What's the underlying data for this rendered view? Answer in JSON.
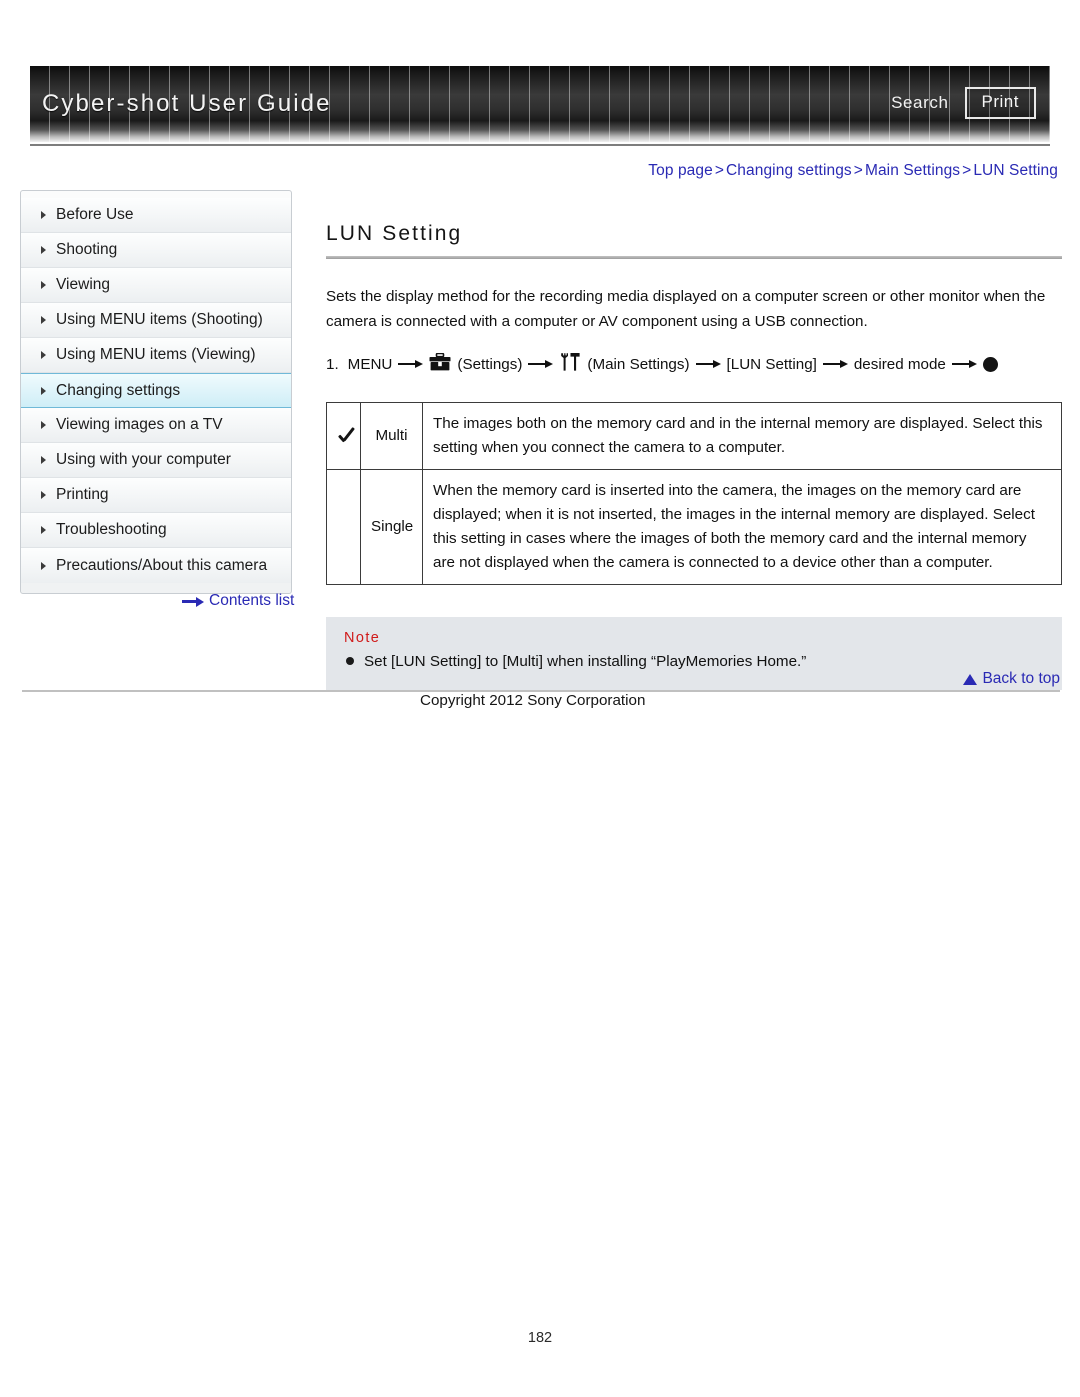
{
  "header": {
    "brand_title": "Cyber-shot User Guide",
    "search_label": "Search",
    "print_label": "Print",
    "search_icon": "search-icon",
    "print_icon": "print-icon"
  },
  "breadcrumb": {
    "items": [
      "Top page",
      "Changing settings",
      "Main Settings",
      "LUN Setting"
    ],
    "separator": ">"
  },
  "sidebar": {
    "items": [
      {
        "label": "Before Use",
        "active": false
      },
      {
        "label": "Shooting",
        "active": false
      },
      {
        "label": "Viewing",
        "active": false
      },
      {
        "label": "Using MENU items (Shooting)",
        "active": false
      },
      {
        "label": "Using MENU items (Viewing)",
        "active": false
      },
      {
        "label": "Changing settings",
        "active": true
      },
      {
        "label": "Viewing images on a TV",
        "active": false
      },
      {
        "label": "Using with your computer",
        "active": false
      },
      {
        "label": "Printing",
        "active": false
      },
      {
        "label": "Troubleshooting",
        "active": false
      },
      {
        "label": "Precautions/About this camera",
        "active": false
      }
    ],
    "contents_link": "Contents list",
    "contents_icon": "arrow-right-icon"
  },
  "main": {
    "title": "LUN Setting",
    "intro": "Sets the display method for the recording media displayed on a computer screen or other monitor when the camera is connected with a computer or AV component using a USB connection.",
    "step": {
      "number": "1.",
      "menu_label": "MENU",
      "settings_icon": "toolbox-settings-icon",
      "settings_label": "(Settings)",
      "main_settings_icon": "wrench-screwdriver-icon",
      "main_settings_label": "(Main Settings)",
      "item_label": "[LUN Setting]",
      "desired_label": "desired mode",
      "confirm_icon": "control-button-dot-icon",
      "arrow_icon": "arrow-right-icon"
    },
    "table": {
      "rows": [
        {
          "checked": true,
          "check_icon": "checkmark-icon",
          "name": "Multi",
          "description": "The images both on the memory card and in the internal memory are displayed. Select this setting when you connect the camera to a computer."
        },
        {
          "checked": false,
          "check_icon": "",
          "name": "Single",
          "description": "When the memory card is inserted into the camera, the images on the memory card are displayed; when it is not inserted, the images in the internal memory are displayed. Select this setting in cases where the images of both the memory card and the internal memory are not displayed when the camera is connected to a device other than a computer."
        }
      ]
    },
    "note": {
      "title": "Note",
      "items": [
        "Set [LUN Setting] to [Multi] when installing “PlayMemories Home.”"
      ]
    }
  },
  "footer": {
    "back_to_top": "Back to top",
    "back_to_top_icon": "triangle-up-icon",
    "copyright": "Copyright 2012 Sony Corporation",
    "page_number": "182"
  },
  "colors": {
    "link_blue": "#2a2ab4",
    "note_red": "#d01a1a",
    "note_bg": "#e3e6ea",
    "active_nav": "#cfeef7"
  }
}
